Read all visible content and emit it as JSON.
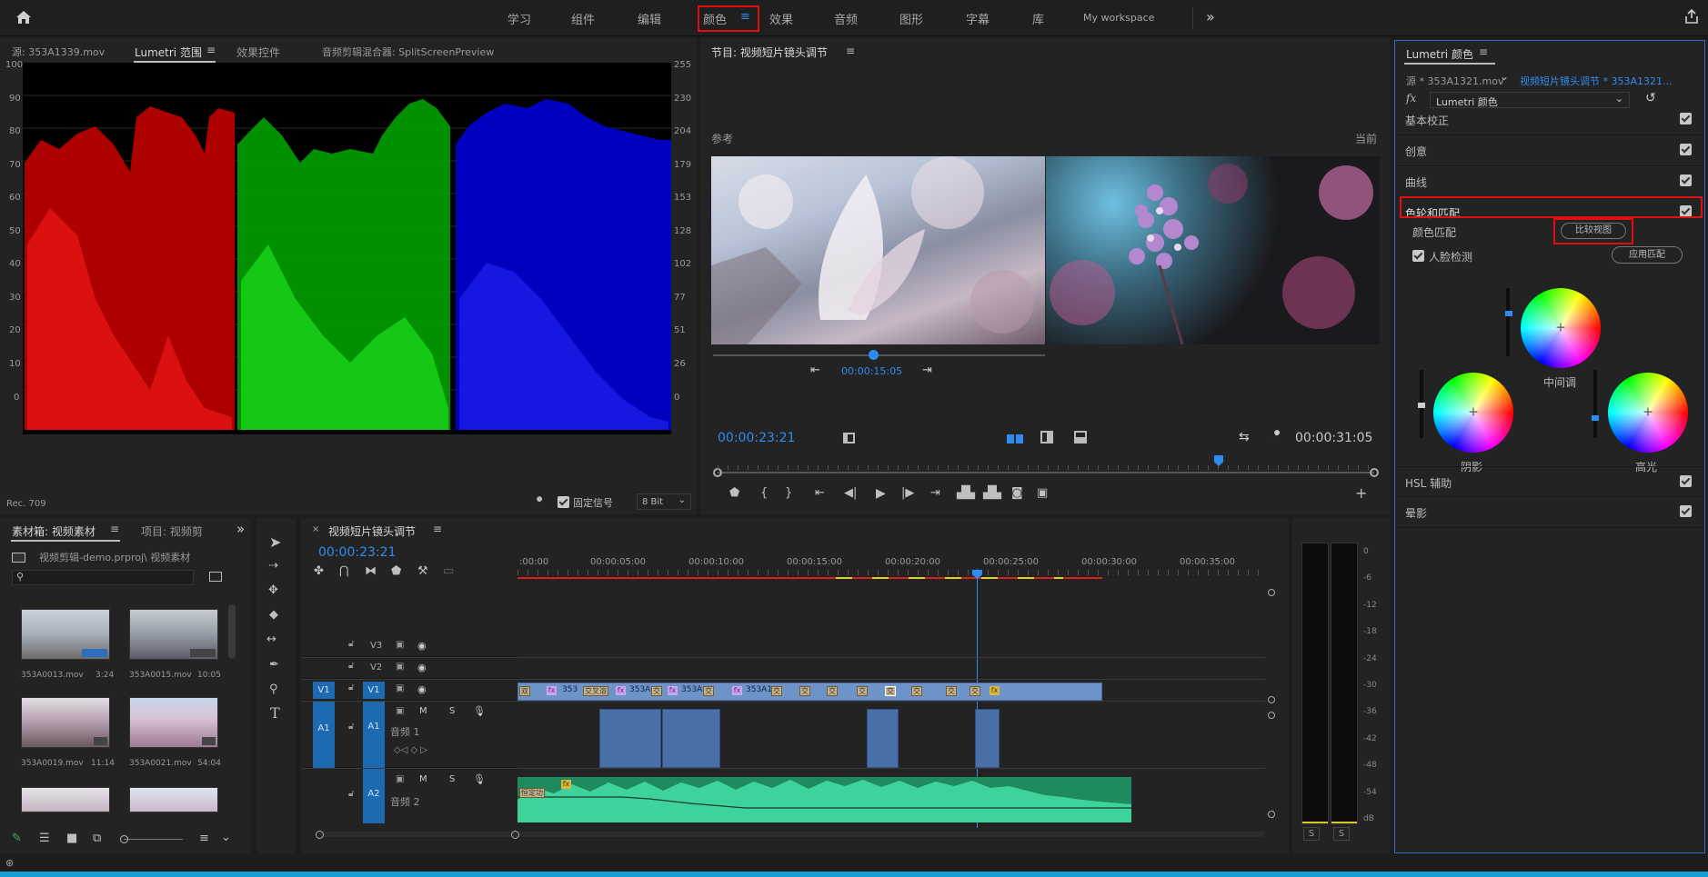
{
  "topbar": {
    "tabs": [
      "学习",
      "组件",
      "编辑",
      "颜色",
      "效果",
      "音频",
      "图形",
      "字幕",
      "库",
      "My workspace"
    ],
    "active_tab": "颜色"
  },
  "source_panel": {
    "tabs": [
      "源: 353A1339.mov",
      "Lumetri 范围",
      "效果控件",
      "音频剪辑混合器: SplitScreenPreview"
    ],
    "left_scale": [
      "100",
      "90",
      "80",
      "70",
      "60",
      "50",
      "40",
      "30",
      "20",
      "10",
      "0"
    ],
    "right_scale": [
      "255",
      "230",
      "204",
      "179",
      "153",
      "128",
      "102",
      "77",
      "51",
      "26",
      "0"
    ],
    "footer_left": "Rec. 709",
    "clamp_label": "固定信号",
    "bitdepth": "8 Bit"
  },
  "program_panel": {
    "title": "节目: 视频短片镜头调节",
    "reference_label": "参考",
    "current_label": "当前",
    "ref_timecode": "00:00:15:05",
    "timecode": "00:00:23:21",
    "duration": "00:00:31:05"
  },
  "lumetri": {
    "title": "Lumetri 颜色",
    "source": "源 * 353A1321.mov",
    "sequence": "视频短片镜头调节 * 353A1321...",
    "effect": "Lumetri 颜色",
    "sections": [
      "基本校正",
      "创意",
      "曲线",
      "色轮和匹配"
    ],
    "color_match": "颜色匹配",
    "compare_button": "比较视图",
    "face_detect": "人脸检测",
    "apply_button": "应用匹配",
    "wheels": {
      "midtones": "中间调",
      "shadows": "阴影",
      "highlights": "高光"
    },
    "bottom_sections": [
      "HSL 辅助",
      "晕影"
    ]
  },
  "bin_panel": {
    "tabs": [
      "素材箱: 视频素材",
      "项目: 视频剪"
    ],
    "path": "视频剪辑-demo.prproj\\ 视频素材",
    "items": [
      {
        "name": "353A0013.mov",
        "dur": "3:24"
      },
      {
        "name": "353A0015.mov",
        "dur": "10:05"
      },
      {
        "name": "353A0019.mov",
        "dur": "11:14"
      },
      {
        "name": "353A0021.mov",
        "dur": "54:04"
      }
    ]
  },
  "timeline": {
    "title": "视频短片镜头调节",
    "timecode": "00:00:23:21",
    "ruler": [
      ":00:00",
      "00:00:05:00",
      "00:00:10:00",
      "00:00:15:00",
      "00:00:20:00",
      "00:00:25:00",
      "00:00:30:00",
      "00:00:35:00"
    ],
    "tracks": {
      "v3": "V3",
      "v2": "V2",
      "v1": "V1",
      "v1_src": "V1",
      "a1": "A1",
      "a1_src": "A1",
      "a1_name": "音频 1",
      "a2": "A2",
      "a2_name": "音频 2",
      "m": "M",
      "s": "S"
    },
    "clip_labels": [
      "353",
      "353A",
      "353A",
      "353A1"
    ]
  },
  "meter": {
    "scale": [
      "0",
      "-6",
      "-12",
      "-18",
      "-24",
      "-30",
      "-36",
      "-42",
      "-48",
      "-54",
      "dB"
    ],
    "solo": [
      "S",
      "S"
    ]
  }
}
